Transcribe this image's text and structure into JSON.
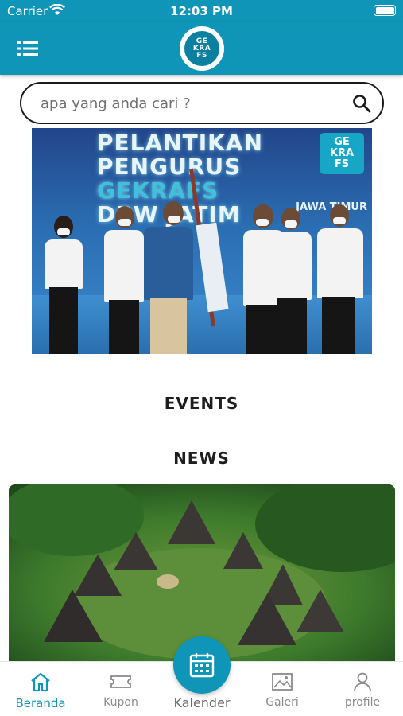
{
  "status": {
    "carrier": "Carrier",
    "time": "12:03 PM"
  },
  "appbar": {
    "menu_icon": "list-menu-icon",
    "logo_lines": [
      "GE",
      "KRA",
      "FS"
    ]
  },
  "search": {
    "placeholder": "apa yang anda cari ?",
    "icon": "search-icon"
  },
  "banner": {
    "title_lines": [
      "PELANTIKAN",
      "PENGURUS",
      "GEKRAFS",
      "DPW JATIM"
    ],
    "logo_lines": [
      "GE",
      "KRA",
      "FS"
    ],
    "region": "JAWA TIMUR"
  },
  "sections": {
    "events": "EVENTS",
    "news": "NEWS"
  },
  "tabbar": {
    "items": [
      {
        "label": "Beranda",
        "icon": "home-icon",
        "active": true
      },
      {
        "label": "Kupon",
        "icon": "ticket-icon",
        "active": false
      },
      {
        "label": "Kalender",
        "icon": "calendar-icon",
        "active": false
      },
      {
        "label": "Galeri",
        "icon": "image-icon",
        "active": false
      },
      {
        "label": "profile",
        "icon": "user-icon",
        "active": false
      }
    ]
  },
  "colors": {
    "primary": "#0f95b7",
    "inactive": "#8a8a8a"
  }
}
